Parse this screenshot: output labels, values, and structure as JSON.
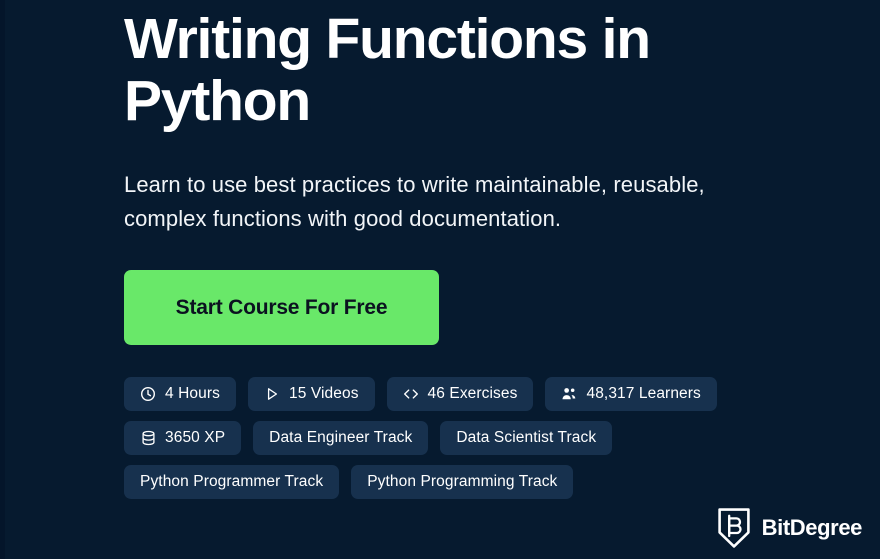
{
  "theme": {
    "background": "#061a2f",
    "pill_background": "#17314e",
    "cta_background": "#69e869",
    "cta_text": "#0b1220",
    "text": "#ffffff"
  },
  "hero": {
    "title": "Writing Functions in Python",
    "subtitle": "Learn to use best practices to write maintainable, reusable, complex functions with good documentation.",
    "cta_label": "Start Course For Free"
  },
  "pill_rows": [
    {
      "pills": [
        {
          "icon": "clock-icon",
          "label": "4 Hours"
        },
        {
          "icon": "play-icon",
          "label": "15 Videos"
        },
        {
          "icon": "code-icon",
          "label": "46 Exercises"
        },
        {
          "icon": "users-icon",
          "label": "48,317 Learners"
        }
      ]
    },
    {
      "pills": [
        {
          "icon": "database-icon",
          "label": "3650 XP"
        },
        {
          "icon": "",
          "label": "Data Engineer Track"
        },
        {
          "icon": "",
          "label": "Data Scientist Track"
        }
      ]
    },
    {
      "pills": [
        {
          "icon": "",
          "label": "Python Programmer Track"
        },
        {
          "icon": "",
          "label": "Python Programming Track"
        }
      ]
    }
  ],
  "brand": {
    "name": "BitDegree",
    "mark": "shield-b-icon"
  }
}
